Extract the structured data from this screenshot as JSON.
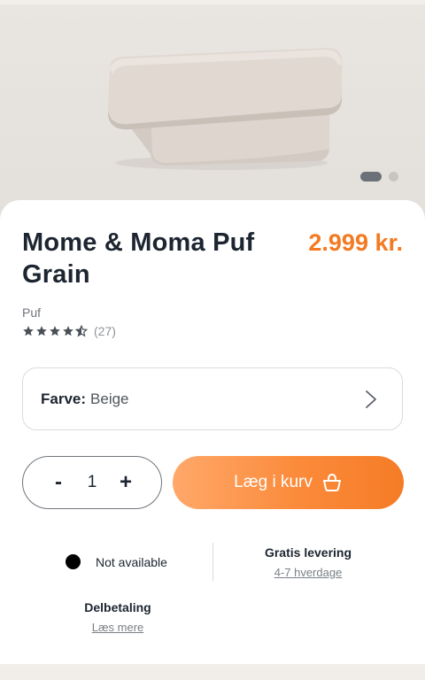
{
  "product": {
    "title": "Mome & Moma Puf Grain",
    "price": "2.999 kr.",
    "category": "Puf",
    "rating": {
      "stars": 4.5,
      "max": 5,
      "count_label": "(27)"
    }
  },
  "gallery": {
    "current": 1,
    "total": 2
  },
  "color_select": {
    "label": "Farve:",
    "value": "Beige"
  },
  "quantity": {
    "minus": "-",
    "value": "1",
    "plus": "+"
  },
  "add_to_cart": {
    "label": "Læg i kurv"
  },
  "availability": {
    "text": "Not available"
  },
  "delivery": {
    "title": "Gratis levering",
    "link": "4-7 hverdage"
  },
  "payment": {
    "title": "Delbetaling",
    "link": "Læs mere"
  },
  "colors": {
    "accent": "#f37a22",
    "text": "#1c2530"
  }
}
